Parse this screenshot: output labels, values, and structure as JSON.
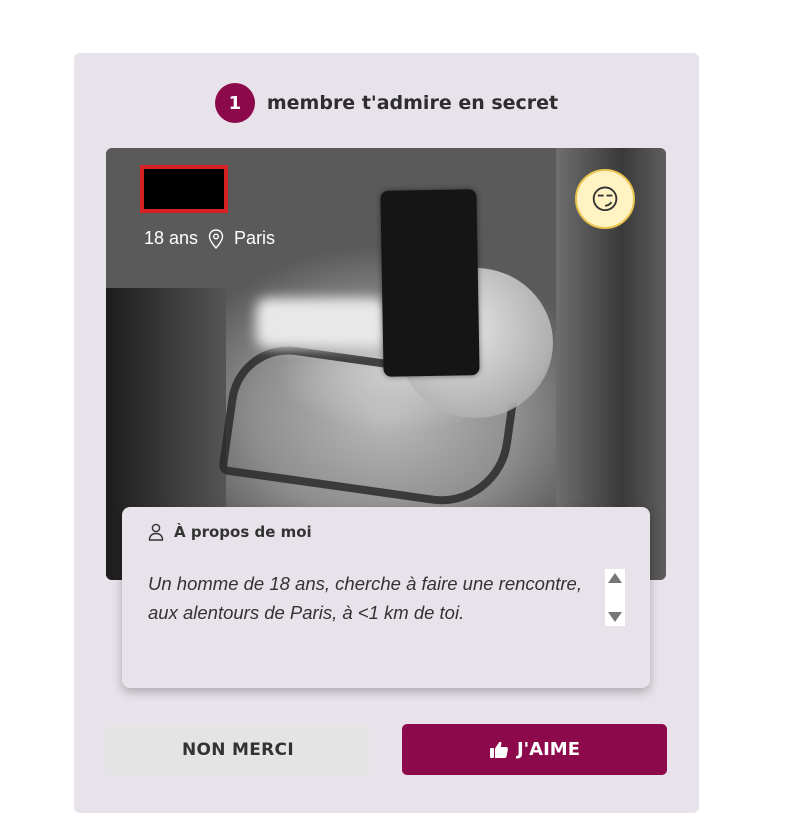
{
  "header": {
    "count": "1",
    "text": "membre t'admire en secret"
  },
  "profile": {
    "age": "18 ans",
    "location": "Paris",
    "reaction_icon": "smirk-emoji",
    "reaction_glyph": "😏"
  },
  "about": {
    "title": "À propos de moi",
    "text": "Un homme de 18 ans, cherche à faire une rencontre, aux alentours de Paris, à <1 km de toi."
  },
  "actions": {
    "decline_label": "NON MERCI",
    "like_label": "J'AIME"
  },
  "colors": {
    "accent": "#8c0a4b",
    "card_bg": "#e8e2ea",
    "name_redaction_border": "#d42124"
  }
}
